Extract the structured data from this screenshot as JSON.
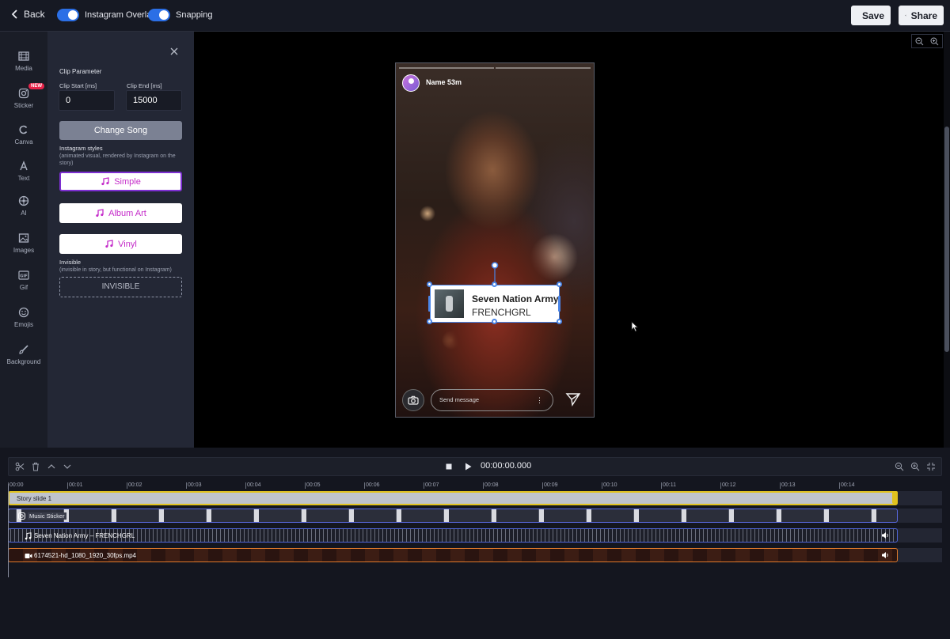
{
  "topbar": {
    "back_label": "Back",
    "toggle_overlay_label": "Instagram Overlay",
    "toggle_snapping_label": "Snapping",
    "save_label": "Save",
    "share_label": "Share"
  },
  "rail": {
    "new_badge": "NEW",
    "items": [
      {
        "label": "Media",
        "icon": "film-icon"
      },
      {
        "label": "Sticker",
        "icon": "instagram-icon"
      },
      {
        "label": "Canva",
        "icon": "canva-icon"
      },
      {
        "label": "Text",
        "icon": "text-icon"
      },
      {
        "label": "AI",
        "icon": "ai-icon"
      },
      {
        "label": "Images",
        "icon": "image-icon"
      },
      {
        "label": "Gif",
        "icon": "gif-icon"
      },
      {
        "label": "Emojis",
        "icon": "emoji-icon"
      },
      {
        "label": "Background",
        "icon": "brush-icon"
      }
    ]
  },
  "panel": {
    "title": "Clip Parameter",
    "clip_start_label": "Clip Start [ms]",
    "clip_start_value": "0",
    "clip_end_label": "Clip End [ms]",
    "clip_end_value": "15000",
    "change_song_label": "Change Song",
    "styles_heading": "Instagram styles",
    "styles_note": "(animated visual, rendered by Instagram on the story)",
    "style_simple": "Simple",
    "style_album_art": "Album Art",
    "style_vinyl": "Vinyl",
    "invisible_heading": "Invisible",
    "invisible_note": "(invisible in story, but functional on Instagram)",
    "invisible_button": "INVISIBLE"
  },
  "story": {
    "username": "Name 53m",
    "message_placeholder": "Send message",
    "more_glyph": "⋮",
    "sticker_title": "Seven Nation Army",
    "sticker_artist": "FRENCHGRL"
  },
  "timeline": {
    "timecode": "00:00:00.000",
    "ticks": [
      "00:00",
      "00:01",
      "00:02",
      "00:03",
      "00:04",
      "00:05",
      "00:06",
      "00:07",
      "00:08",
      "00:09",
      "00:10",
      "00:11",
      "00:12",
      "00:13",
      "00:14"
    ],
    "tracks": {
      "story": "Story slide 1",
      "music_sticker": "Music Sticker",
      "audio": "Seven Nation Army – FRENCHGRL",
      "video": "6174521-hd_1080_1920_30fps.mp4"
    }
  },
  "colors": {
    "accent_blue": "#2b6fe6",
    "story_track": "#e1c21f",
    "video_track": "#e07a2c",
    "audio_track": "#4f65d6",
    "style_text": "#c42bc9"
  }
}
